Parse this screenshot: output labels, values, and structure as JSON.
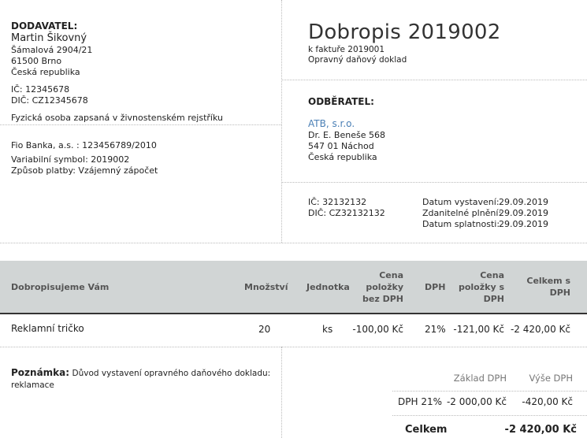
{
  "supplier": {
    "heading": "DODAVATEL:",
    "name": "Martin Šikovný",
    "street": "Šámalová 2904/21",
    "city": "61500 Brno",
    "country": "Česká republika",
    "ic": "IČ: 12345678",
    "dic": "DIČ: CZ12345678",
    "note": "Fyzická osoba zapsaná v živnostenském rejstříku"
  },
  "payment": {
    "bank": "Fio Banka, a.s. : 123456789/2010",
    "variable_symbol": "Variabilní symbol: 2019002",
    "method": "Způsob platby: Vzájemný zápočet"
  },
  "document": {
    "title": "Dobropis 2019002",
    "invoice_ref": "k faktuře 2019001",
    "type": "Opravný daňový doklad"
  },
  "customer": {
    "heading": "ODBĚRATEL:",
    "name": "ATB, s.r.o.",
    "street": "Dr. E. Beneše 568",
    "city": "547 01 Náchod",
    "country": "Česká republika",
    "ic": "IČ: 32132132",
    "dic": "DIČ: CZ32132132"
  },
  "dates": [
    {
      "label": "Datum vystavení:",
      "value": "29.09.2019"
    },
    {
      "label": "Zdanitelné plnění:",
      "value": "29.09.2019"
    },
    {
      "label": "Datum splatnosti:",
      "value": "29.09.2019"
    }
  ],
  "table": {
    "headers": {
      "description": "Dobropisujeme Vám",
      "quantity": "Množství",
      "unit": "Jednotka",
      "price_line1": "Cena",
      "price_line2": "položky",
      "price_line3": "bez DPH",
      "vat": "DPH",
      "price_vat_line1": "Cena",
      "price_vat_line2": "položky s",
      "price_vat_line3": "DPH",
      "total_line1": "Celkem s",
      "total_line2": "DPH"
    },
    "rows": [
      {
        "description": "Reklamní tričko",
        "quantity": "20",
        "unit": "ks",
        "price": "-100,00 Kč",
        "vat": "21%",
        "price_vat": "-121,00 Kč",
        "total": "-2 420,00 Kč"
      }
    ]
  },
  "note": {
    "label": "Poznámka:",
    "text_line1": "Důvod vystavení opravného daňového dokladu:",
    "text_line2": "reklamace"
  },
  "summary": {
    "base_header": "Základ DPH",
    "vat_header": "Výše DPH",
    "rows": [
      {
        "rate": "DPH 21%",
        "base": "-2 000,00 Kč",
        "vat": "-420,00 Kč"
      }
    ],
    "total_label": "Celkem",
    "total_value": "-2 420,00 Kč"
  }
}
